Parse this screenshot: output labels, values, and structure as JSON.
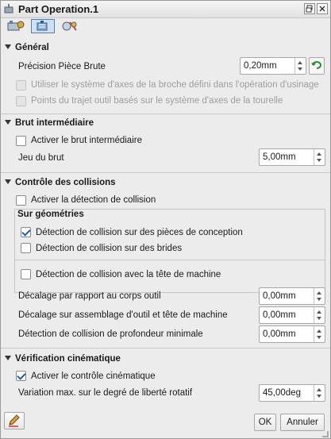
{
  "window": {
    "title": "Part Operation.1"
  },
  "general": {
    "header": "Général",
    "precision_label": "Précision Pièce Brute",
    "precision_value": "0,20mm",
    "option1": "Utiliser le système d'axes de la broche défini dans l'opération d'usinage",
    "option2": "Points du trajet outil basés sur le système d'axes de la tourelle"
  },
  "brut": {
    "header": "Brut intermédiaire",
    "activate_label": "Activer le brut intermédiaire",
    "jeu_label": "Jeu du brut",
    "jeu_value": "5,00mm"
  },
  "collisions": {
    "header": "Contrôle des collisions",
    "activate_label": "Activer la détection de collision",
    "geom_header": "Sur géométries",
    "pieces_label": "Détection de collision sur des pièces de conception",
    "brides_label": "Détection de collision sur des brides",
    "tete_label": "Détection de collision avec la tête de machine",
    "decalage_corps_label": "Décalage par rapport au corps outil",
    "decalage_corps_value": "0,00mm",
    "decalage_assemblage_label": "Décalage sur assemblage d'outil et tête de machine",
    "decalage_assemblage_value": "0,00mm",
    "profondeur_label": "Détection de collision de profondeur minimale",
    "profondeur_value": "0,00mm"
  },
  "kinematics": {
    "header": "Vérification cinématique",
    "activate_label": "Activer le contrôle cinématique",
    "variation_label": "Variation max. sur le degré de liberté rotatif",
    "variation_value": "45,00deg"
  },
  "footer": {
    "ok_label": "OK",
    "cancel_label": "Annuler"
  }
}
